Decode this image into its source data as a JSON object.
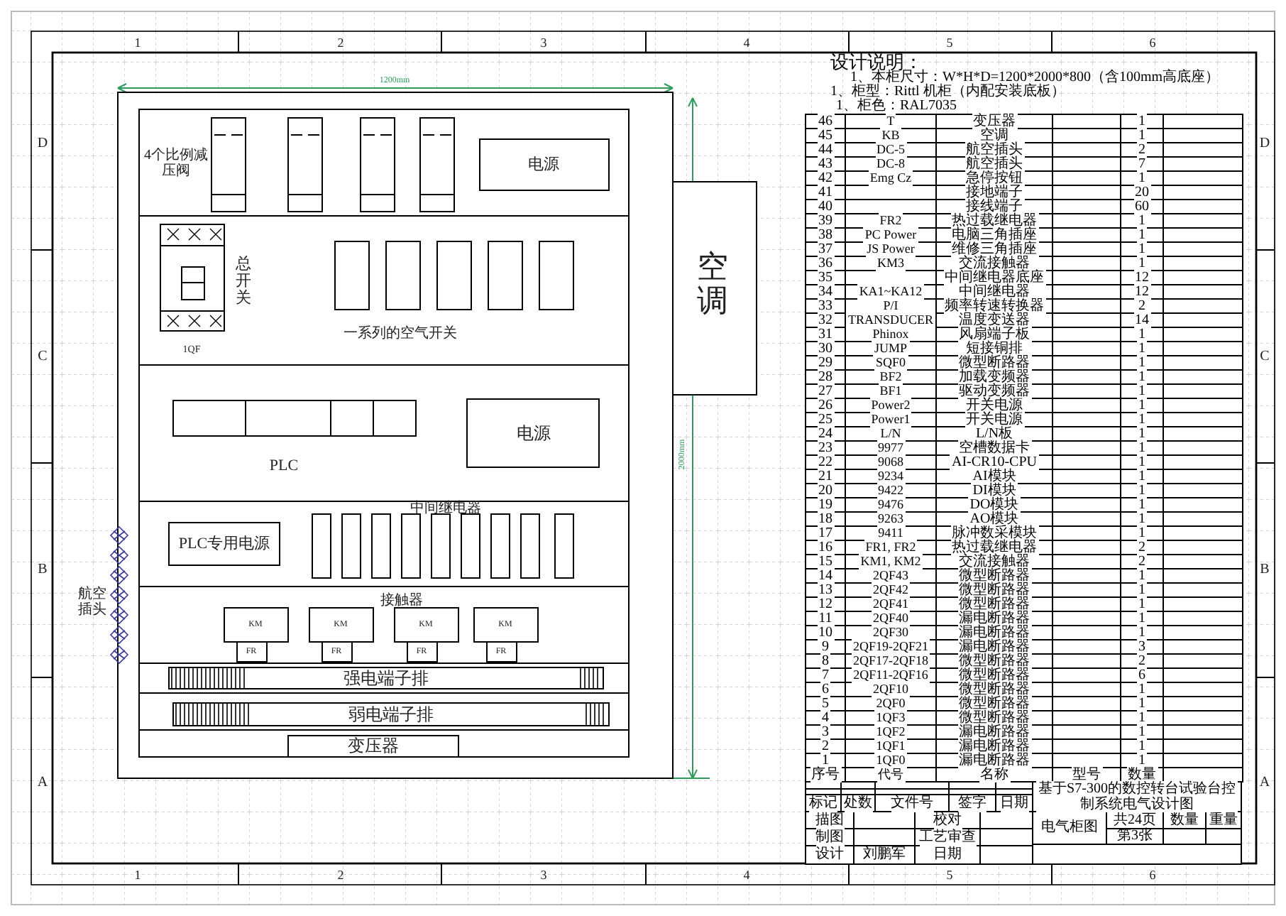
{
  "frame": {
    "top_column_numbers": [
      "1",
      "2",
      "3",
      "4",
      "5",
      "6"
    ],
    "bottom_column_numbers": [
      "1",
      "2",
      "3",
      "4",
      "5",
      "6"
    ],
    "left_row_letters": [
      "D",
      "C",
      "B",
      "A"
    ],
    "right_row_letters": [
      "D",
      "C",
      "B",
      "A"
    ]
  },
  "cabinet": {
    "width_dimension": "1200mm",
    "height_dimension": "2000mm",
    "valves_label": "4个比例减压阀",
    "power_supply_top": "电源",
    "main_switch": "总开关",
    "main_switch_code": "1QF",
    "air_switches_label": "一系列的空气开关",
    "power_supply_mid": "电源",
    "plc_label": "PLC",
    "relays_label": "中间继电器",
    "plc_power": "PLC专用电源",
    "contactors_label": "接触器",
    "contactors": [
      {
        "code": "KM",
        "overload": "FR"
      },
      {
        "code": "KM",
        "overload": "FR"
      },
      {
        "code": "KM",
        "overload": "FR"
      },
      {
        "code": "KM",
        "overload": "FR"
      }
    ],
    "strong_terminals": "强电端子排",
    "weak_terminals": "弱电端子排",
    "transformer": "变压器",
    "air_conditioner": "空调",
    "aviation_plugs": "航空插头"
  },
  "notes": {
    "title": "设计说明：",
    "lines": [
      "1、本柜尺寸：W*H*D=1200*2000*800（含100mm高底座）",
      "1、柜型：Rittl 机柜（内配安装底板）",
      "1、柜色：RAL7035"
    ]
  },
  "parts_table": {
    "columns": [
      "序号",
      "代号",
      "名称",
      "型号",
      "数量"
    ],
    "rows": [
      {
        "no": "46",
        "code": "T",
        "name": "变压器",
        "qty": "1"
      },
      {
        "no": "45",
        "code": "KB",
        "name": "空调",
        "qty": "1"
      },
      {
        "no": "44",
        "code": "DC-5",
        "name": "航空插头",
        "qty": "2"
      },
      {
        "no": "43",
        "code": "DC-8",
        "name": "航空插头",
        "qty": "7"
      },
      {
        "no": "42",
        "code": "Emg Cz",
        "name": "急停按钮",
        "qty": "1"
      },
      {
        "no": "41",
        "name": "接地端子",
        "qty": "20"
      },
      {
        "no": "40",
        "name": "接线端子",
        "qty": "60"
      },
      {
        "no": "39",
        "code": "FR2",
        "name": "热过载继电器",
        "qty": "1"
      },
      {
        "no": "38",
        "code": "PC Power",
        "name": "电脑三角插座",
        "qty": "1"
      },
      {
        "no": "37",
        "code": "JS Power",
        "name": "维修三角插座",
        "qty": "1"
      },
      {
        "no": "36",
        "code": "KM3",
        "name": "交流接触器",
        "qty": "1"
      },
      {
        "no": "35",
        "name": "中间继电器底座",
        "qty": "12"
      },
      {
        "no": "34",
        "code": "KA1~KA12",
        "name": "中间继电器",
        "qty": "12"
      },
      {
        "no": "33",
        "code": "P/I",
        "name": "频率转速转换器",
        "qty": "2"
      },
      {
        "no": "32",
        "code": "TRANSDUCER",
        "name": "温度变送器",
        "qty": "14"
      },
      {
        "no": "31",
        "code": "Phinox",
        "name": "风扇端子板",
        "qty": "1"
      },
      {
        "no": "30",
        "code": "JUMP",
        "name": "短接铜排",
        "qty": "1"
      },
      {
        "no": "29",
        "code": "SQF0",
        "name": "微型断路器",
        "qty": "1"
      },
      {
        "no": "28",
        "code": "BF2",
        "name": "加载变频器",
        "qty": "1"
      },
      {
        "no": "27",
        "code": "BF1",
        "name": "驱动变频器",
        "qty": "1"
      },
      {
        "no": "26",
        "code": "Power2",
        "name": "开关电源",
        "qty": "1"
      },
      {
        "no": "25",
        "code": "Power1",
        "name": "开关电源",
        "qty": "1"
      },
      {
        "no": "24",
        "code": "L/N",
        "name": "L/N板",
        "qty": "1"
      },
      {
        "no": "23",
        "code": "9977",
        "name": "空槽数据卡",
        "qty": "1"
      },
      {
        "no": "22",
        "code": "9068",
        "name": "AI-CR10-CPU",
        "qty": "1"
      },
      {
        "no": "21",
        "code": "9234",
        "name": "AI模块",
        "qty": "1"
      },
      {
        "no": "20",
        "code": "9422",
        "name": "DI模块",
        "qty": "1"
      },
      {
        "no": "19",
        "code": "9476",
        "name": "DO模块",
        "qty": "1"
      },
      {
        "no": "18",
        "code": "9263",
        "name": "AO模块",
        "qty": "1"
      },
      {
        "no": "17",
        "code": "9411",
        "name": "脉冲数采模块",
        "qty": "1"
      },
      {
        "no": "16",
        "code": "FR1, FR2",
        "name": "热过载继电器",
        "qty": "2"
      },
      {
        "no": "15",
        "code": "KM1, KM2",
        "name": "交流接触器",
        "qty": "2"
      },
      {
        "no": "14",
        "code": "2QF43",
        "name": "微型断路器",
        "qty": "1"
      },
      {
        "no": "13",
        "code": "2QF42",
        "name": "微型断路器",
        "qty": "1"
      },
      {
        "no": "12",
        "code": "2QF41",
        "name": "微型断路器",
        "qty": "1"
      },
      {
        "no": "11",
        "code": "2QF40",
        "name": "漏电断路器",
        "qty": "1"
      },
      {
        "no": "10",
        "code": "2QF30",
        "name": "漏电断路器",
        "qty": "1"
      },
      {
        "no": "9",
        "code": "2QF19-2QF21",
        "name": "漏电断路器",
        "qty": "3"
      },
      {
        "no": "8",
        "code": "2QF17-2QF18",
        "name": "微型断路器",
        "qty": "2"
      },
      {
        "no": "7",
        "code": "2QF11-2QF16",
        "name": "微型断路器",
        "qty": "6"
      },
      {
        "no": "6",
        "code": "2QF10",
        "name": "微型断路器",
        "qty": "1"
      },
      {
        "no": "5",
        "code": "2QF0",
        "name": "微型断路器",
        "qty": "1"
      },
      {
        "no": "4",
        "code": "1QF3",
        "name": "微型断路器",
        "qty": "1"
      },
      {
        "no": "3",
        "code": "1QF2",
        "name": "漏电断路器",
        "qty": "1"
      },
      {
        "no": "2",
        "code": "1QF1",
        "name": "漏电断路器",
        "qty": "1"
      },
      {
        "no": "1",
        "code": "1QF0",
        "name": "漏电断路器",
        "qty": "1"
      }
    ]
  },
  "title_block": {
    "drawing_title": "基于S7-300的数控转台试验台控制系统电气设计图",
    "revision_headers": [
      "标记",
      "处数",
      "文件号",
      "签字",
      "日期"
    ],
    "drawn_by_label": "描图",
    "check_label": "校对",
    "drafted_label": "制图",
    "process_review_label": "工艺审查",
    "designer_label": "设计",
    "designer": "刘鹏军",
    "date_label": "日期",
    "drawing_name": "电气柜图",
    "total_pages": "共24页",
    "sheet": "第3张",
    "quantity_label": "数量",
    "weight_label": "重量"
  }
}
